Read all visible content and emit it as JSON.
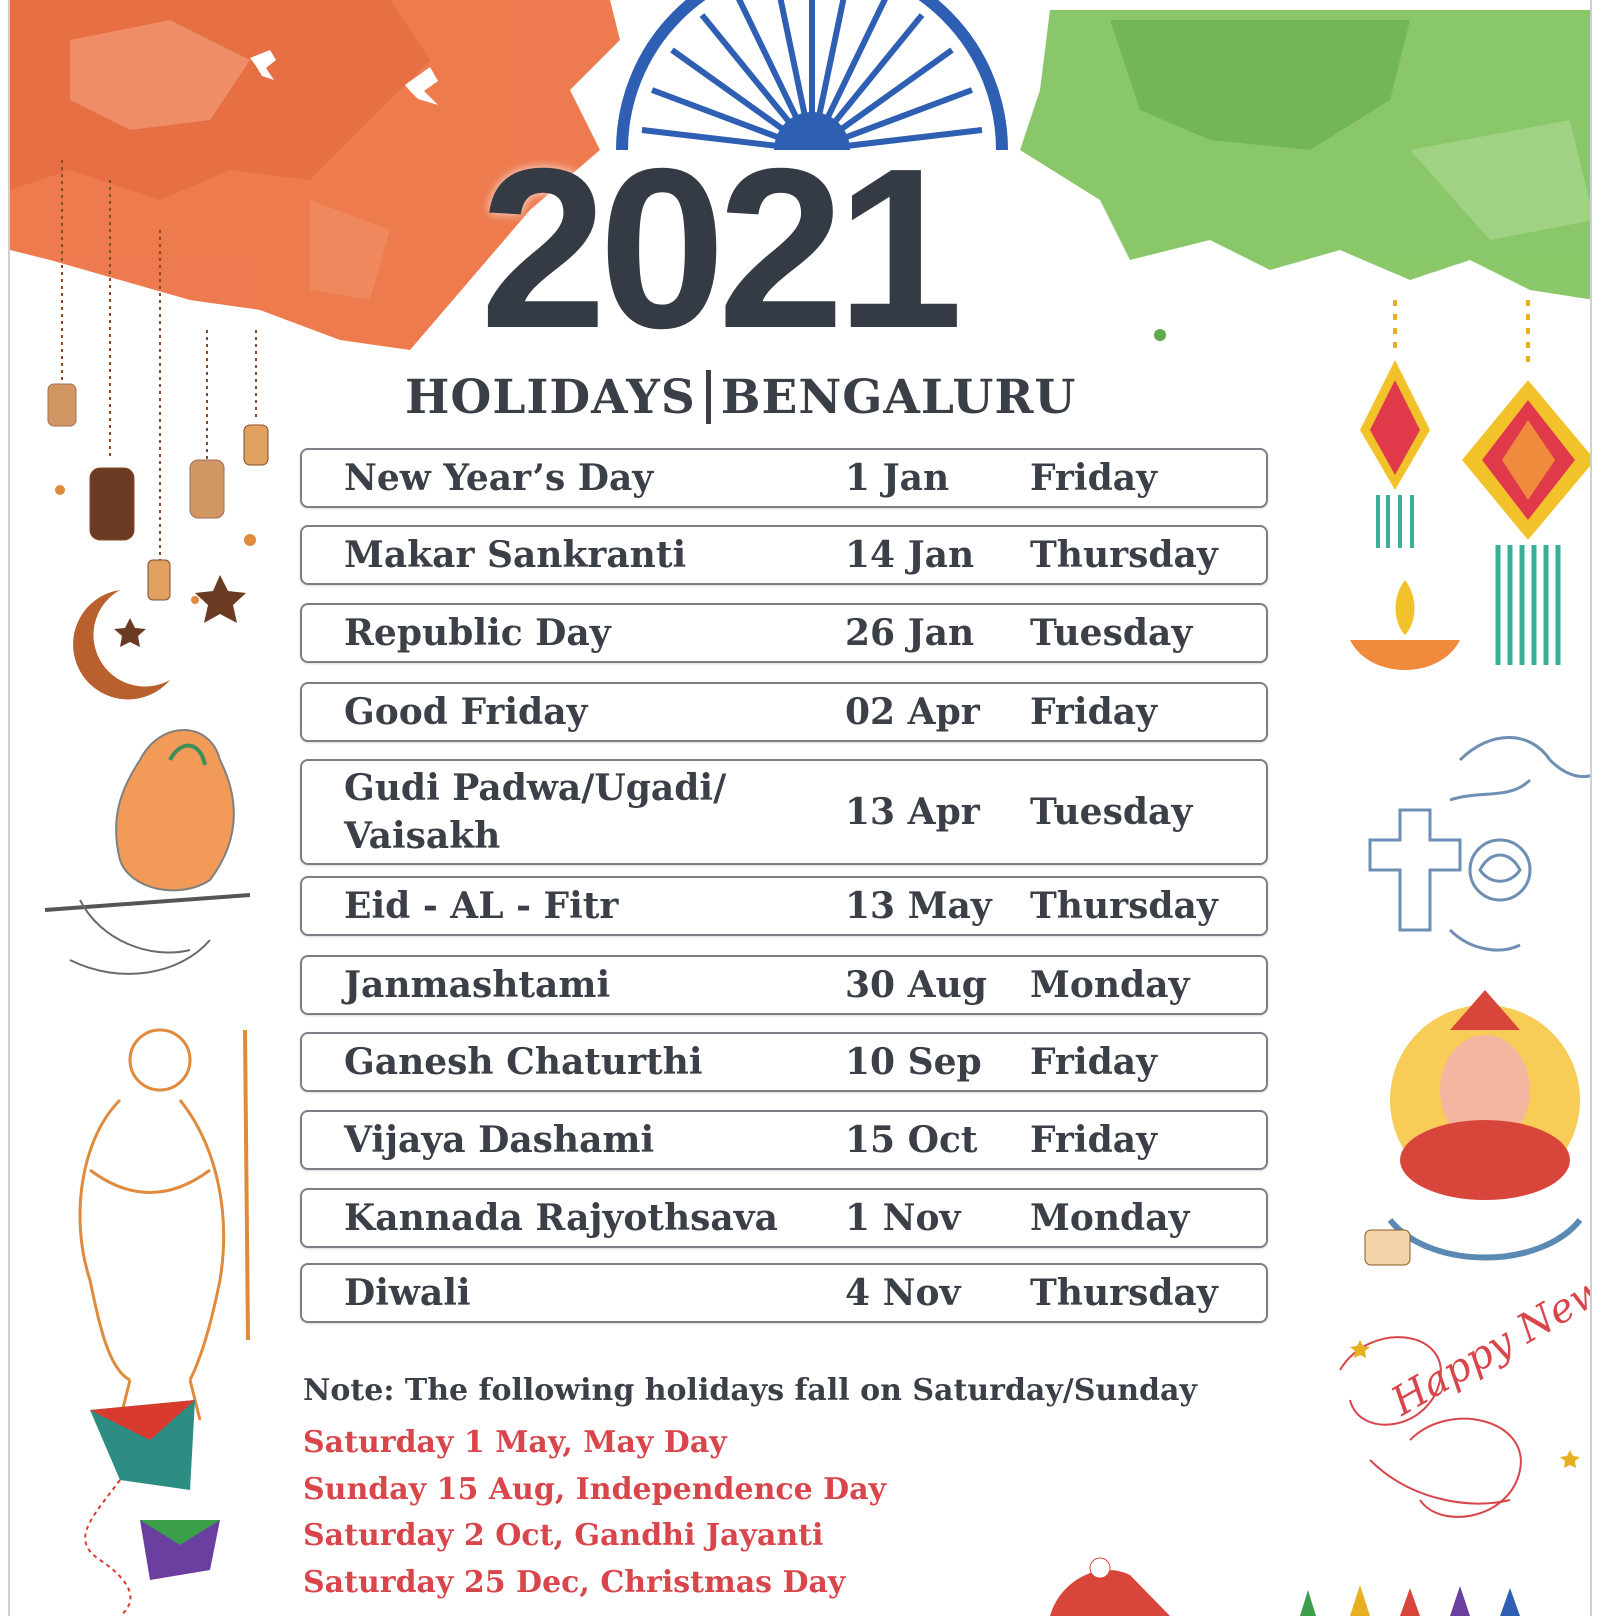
{
  "header": {
    "year": "2021",
    "subtitle_left": "HOLIDAYS",
    "subtitle_right": "BENGALURU"
  },
  "holidays": [
    {
      "name": "New Year’s Day",
      "date": "1 Jan",
      "day": "Friday"
    },
    {
      "name": "Makar Sankranti",
      "date": "14 Jan",
      "day": "Thursday"
    },
    {
      "name": "Republic Day",
      "date": "26 Jan",
      "day": "Tuesday"
    },
    {
      "name": "Good Friday",
      "date": "02 Apr",
      "day": "Friday"
    },
    {
      "name": "Gudi Padwa/Ugadi/ Vaisakh",
      "date": "13 Apr",
      "day": "Tuesday"
    },
    {
      "name": "Eid - AL - Fitr",
      "date": "13 May",
      "day": "Thursday"
    },
    {
      "name": "Janmashtami",
      "date": "30 Aug",
      "day": "Monday"
    },
    {
      "name": "Ganesh Chaturthi",
      "date": "10 Sep",
      "day": "Friday"
    },
    {
      "name": "Vijaya Dashami",
      "date": "15 Oct",
      "day": "Friday"
    },
    {
      "name": "Kannada Rajyothsava",
      "date": "1 Nov",
      "day": "Monday"
    },
    {
      "name": "Diwali",
      "date": "4 Nov",
      "day": "Thursday"
    }
  ],
  "note": "Note: The following holidays fall on Saturday/Sunday",
  "weekend_holidays": [
    "Saturday 1 May,  May Day",
    "Sunday 15 Aug,  Independence Day",
    "Saturday 2 Oct, Gandhi Jayanti",
    "Saturday 25 Dec, Christmas Day"
  ],
  "decorations": {
    "top_left_splash": "saffron-watercolor-splash",
    "top_center_emblem": "ashoka-chakra-half",
    "top_right_splash": "green-watercolor-splash",
    "left_top": "hanging-lanterns-crescent-moon",
    "left_middle": "krishna-flute-illustration",
    "left_lower": "gandhi-walking-sketch",
    "left_bottom": "kites-illustration",
    "right_top": "diwali-kandils-and-diya",
    "right_middle": "cross-angel-rose-sketch",
    "right_lower": "ganesha-illustration",
    "right_bottom": "happy-new-year-script",
    "bottom_center": "santa-figure",
    "bottom_right": "crayons",
    "handwriting_text": "Happy New Year",
    "colors": {
      "saffron": "#e8663a",
      "green": "#6fbf4d",
      "chakra_blue": "#2f5fb3",
      "title_dark": "#353b45",
      "weekend_red": "#d8464b"
    }
  }
}
